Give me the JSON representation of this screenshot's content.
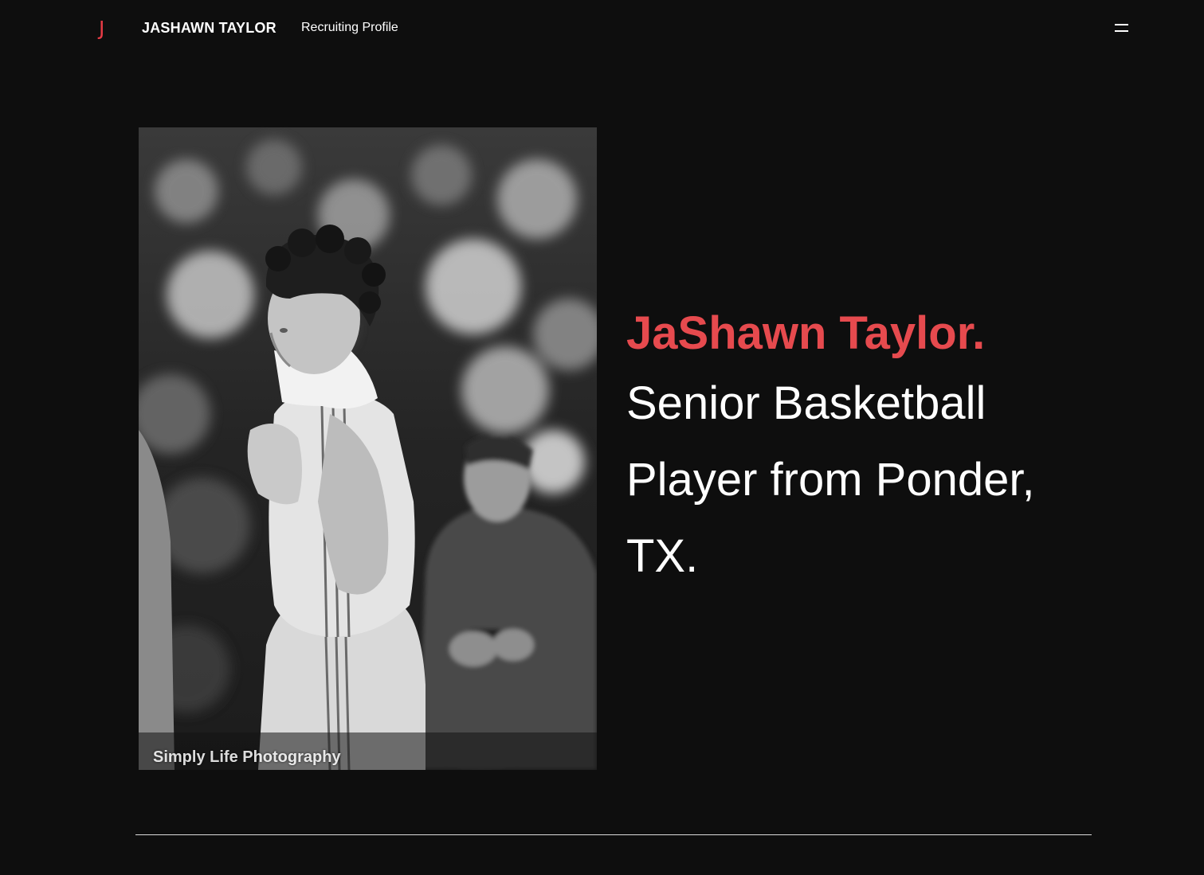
{
  "header": {
    "logo_text": "J",
    "site_name": "JASHAWN TAYLOR",
    "nav_link": "Recruiting Profile",
    "menu_icon": "hamburger-icon"
  },
  "hero": {
    "photo_description_icon": "player-photo",
    "photo_credit": "Simply Life Photography",
    "name": "JaShawn Taylor.",
    "subtitle": "Senior Basketball Player from Ponder, TX."
  },
  "colors": {
    "background": "#0e0e0e",
    "accent": "#e64a4e",
    "text": "#ffffff"
  }
}
